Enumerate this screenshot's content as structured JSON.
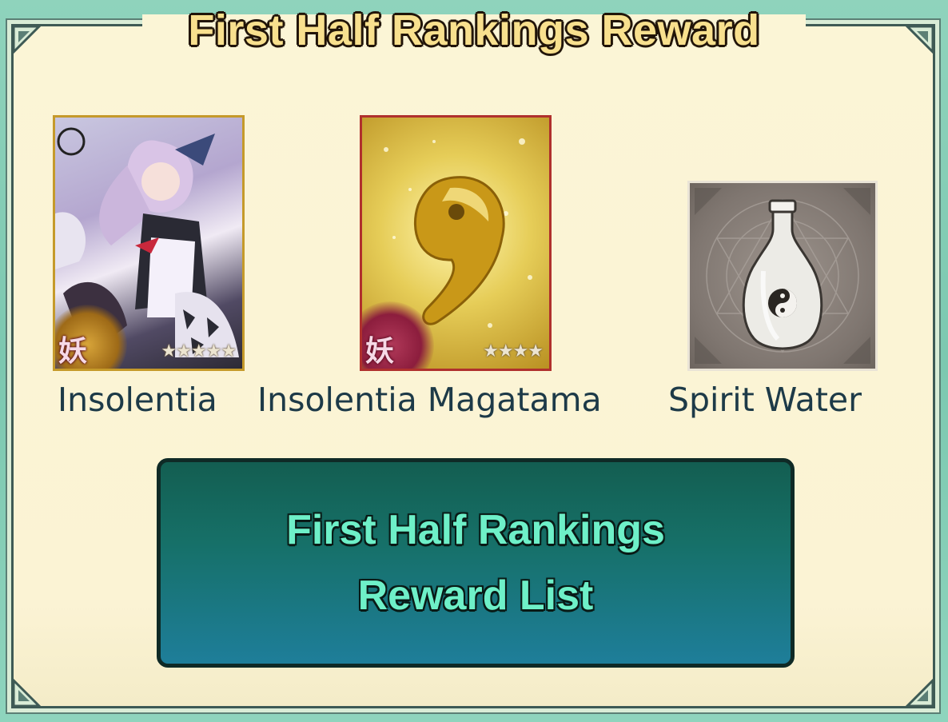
{
  "title": "First Half Rankings Reward",
  "rewards": [
    {
      "name": "Insolentia",
      "type_glyph": "妖",
      "stars": "★★★★★"
    },
    {
      "name": "Insolentia Magatama",
      "type_glyph": "妖",
      "stars": "★★★★"
    },
    {
      "name": "Spirit Water"
    }
  ],
  "button": {
    "line1": "First Half Rankings",
    "line2": "Reward List"
  },
  "colors": {
    "title_text": "#f8e08e",
    "button_text": "#6ef0c8",
    "label_text": "#1d3a48",
    "panel_bg": "#fbf5d6",
    "outer_bg": "#8fd3bc"
  },
  "icons": [
    "character-card-icon",
    "magatama-icon",
    "spirit-water-bottle-icon",
    "yin-yang-icon"
  ]
}
